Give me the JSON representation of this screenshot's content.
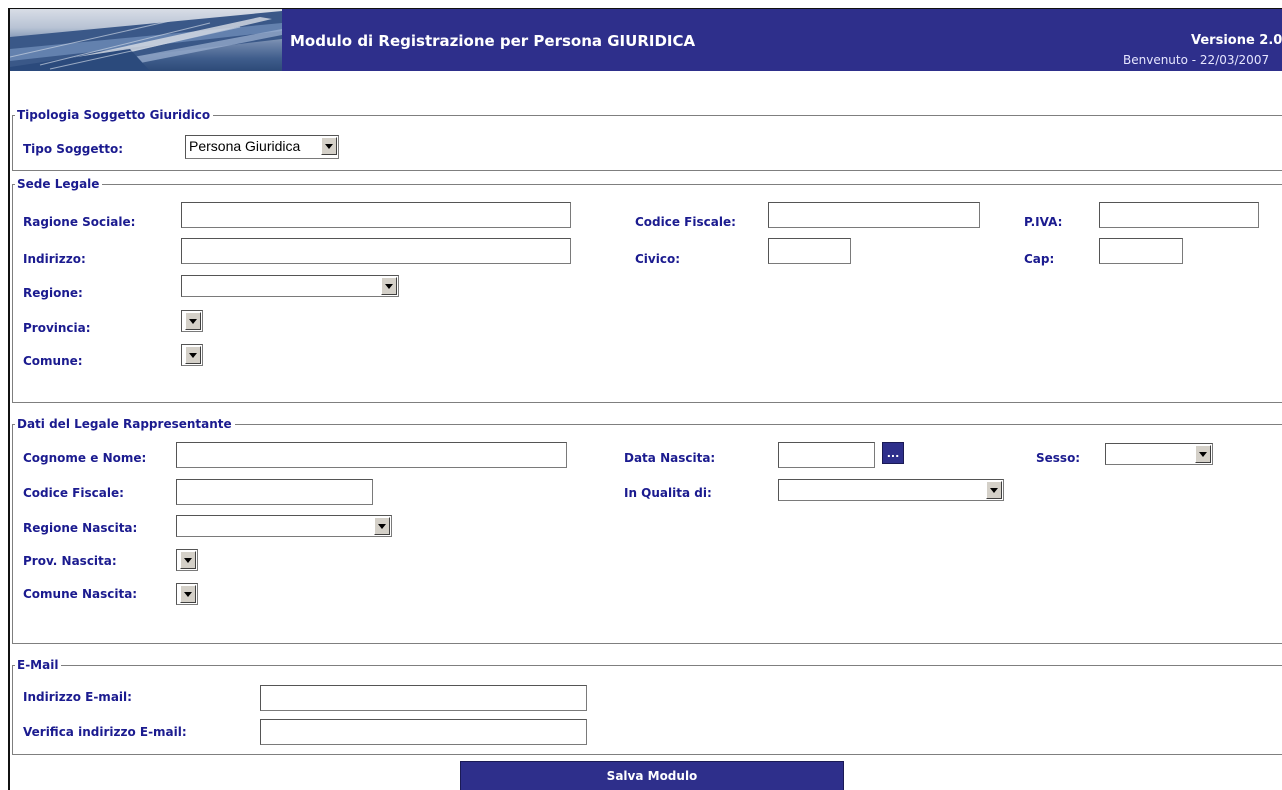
{
  "header": {
    "title": "Modulo di Registrazione per Persona GIURIDICA",
    "version": "Versione 2.0",
    "welcome": "Benvenuto - 22/03/2007"
  },
  "tipologia": {
    "legend": "Tipologia Soggetto Giuridico",
    "tipo_label": "Tipo Soggetto:",
    "tipo_value": "Persona Giuridica"
  },
  "sede": {
    "legend": "Sede Legale",
    "ragione_label": "Ragione Sociale:",
    "codice_label": "Codice Fiscale:",
    "piva_label": "P.IVA:",
    "indirizzo_label": "Indirizzo:",
    "civico_label": "Civico:",
    "cap_label": "Cap:",
    "regione_label": "Regione:",
    "provincia_label": "Provincia:",
    "comune_label": "Comune:"
  },
  "rappresentante": {
    "legend": "Dati del Legale Rappresentante",
    "nome_label": "Cognome e Nome:",
    "nascita_label": "Data Nascita:",
    "picker_label": "...",
    "sesso_label": "Sesso:",
    "codice_label": "Codice Fiscale:",
    "qualita_label": "In Qualita di:",
    "regione_label": "Regione Nascita:",
    "prov_label": "Prov. Nascita:",
    "comune_label": "Comune Nascita:"
  },
  "email": {
    "legend": "E-Mail",
    "indirizzo_label": "Indirizzo E-mail:",
    "verifica_label": "Verifica indirizzo E-mail:"
  },
  "actions": {
    "save_label": "Salva Modulo"
  },
  "colors": {
    "header_bg": "#2e2f8b",
    "label_text": "#1b1b8f"
  }
}
